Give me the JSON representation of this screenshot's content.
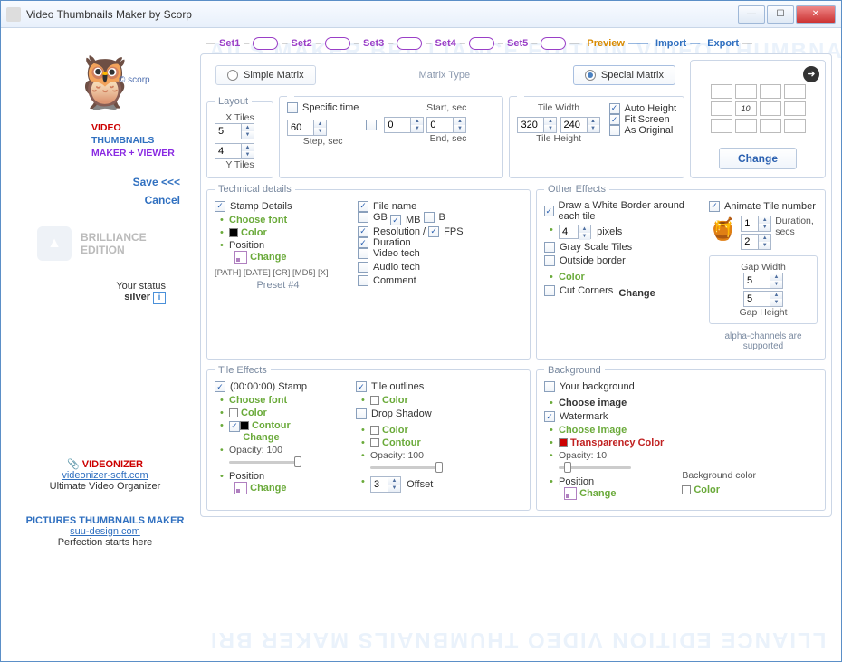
{
  "title": "Video Thumbnails Maker by Scorp",
  "brand": {
    "v": "VIDEO",
    "t": "THUMBNAILS",
    "m": "MAKER + VIEWER",
    "scorp": "© scorp"
  },
  "side": {
    "save": "Save <<<",
    "cancel": "Cancel",
    "edition": "BRILLIANCE EDITION",
    "your_status": "Your status",
    "status_val": "silver",
    "vidz": "VIDEONIZER",
    "vidz_url": "videonizer-soft.com",
    "vidz_sub": "Ultimate Video Organizer",
    "ptm": "PICTURES THUMBNAILS MAKER",
    "ptm_url": "suu-design.com",
    "ptm_sub": "Perfection starts here"
  },
  "tabs": {
    "sets": [
      "Set1",
      "Set2",
      "Set3",
      "Set4",
      "Set5"
    ],
    "preview": "Preview",
    "import": "Import",
    "export": "Export"
  },
  "matrix": {
    "simple": "Simple Matrix",
    "type": "Matrix Type",
    "special": "Special Matrix",
    "selected": "special"
  },
  "layout": {
    "legend": "Layout",
    "xlabel": "X Tiles",
    "ylabel": "Y Tiles",
    "x": "5",
    "y": "4"
  },
  "time": {
    "specific": "Specific time",
    "step": "60",
    "step_lbl": "Step, sec",
    "start_lbl": "Start, sec",
    "end_lbl": "End, sec",
    "start": "0",
    "end": "0"
  },
  "tile": {
    "tw": "320",
    "th": "240",
    "twlbl": "Tile Width",
    "thlbl": "Tile Height",
    "auto": "Auto Height",
    "fit": "Fit Screen",
    "orig": "As Original"
  },
  "preview_pane": {
    "change": "Change",
    "num": "10"
  },
  "tech": {
    "legend": "Technical  details",
    "stamp": "Stamp Details",
    "choosefont": "Choose font",
    "color": "Color",
    "position": "Position",
    "change": "Change",
    "filename": "File name",
    "gb": "GB",
    "mb": "MB",
    "b": "B",
    "resolution": "Resolution / ",
    "fps": "FPS",
    "duration": "Duration",
    "videotech": "Video tech",
    "audiotech": "Audio tech",
    "comment": "Comment",
    "pathline": "[PATH] [DATE] [CR] [MD5] [X]",
    "preset": "Preset #4"
  },
  "other": {
    "legend": "Other Effects",
    "border": "Draw a White Border around each tile",
    "border_px": "4",
    "pixels": "pixels",
    "animate": "Animate Tile number",
    "an1": "1",
    "an2": "2",
    "dursecs": "Duration, secs",
    "gray": "Gray Scale Tiles",
    "outside": "Outside border",
    "color": "Color",
    "cut": "Cut Corners",
    "change": "Change",
    "gapw": "Gap Width",
    "gaph": "Gap Height",
    "gapwv": "5",
    "gaphv": "5",
    "alpha": "alpha-channels are supported"
  },
  "tilefx": {
    "legend": "Tile Effects",
    "tstamp": "(00:00:00) Stamp",
    "choosefont": "Choose font",
    "color": "Color",
    "contour": "Contour",
    "change": "Change",
    "opacity_lbl": "Opacity:",
    "opacity": "100",
    "position": "Position",
    "outlines": "Tile outlines",
    "drop": "Drop Shadow",
    "offset": "3",
    "offset_lbl": "Offset"
  },
  "bg": {
    "legend": "Background",
    "your": "Your background",
    "chooseimg": "Choose image",
    "watermark": "Watermark",
    "trans": "Transparency Color",
    "opacity_lbl": "Opacity:",
    "opacity": "10",
    "position": "Position",
    "change": "Change",
    "bgcolor": "Background color",
    "color": "Color"
  }
}
